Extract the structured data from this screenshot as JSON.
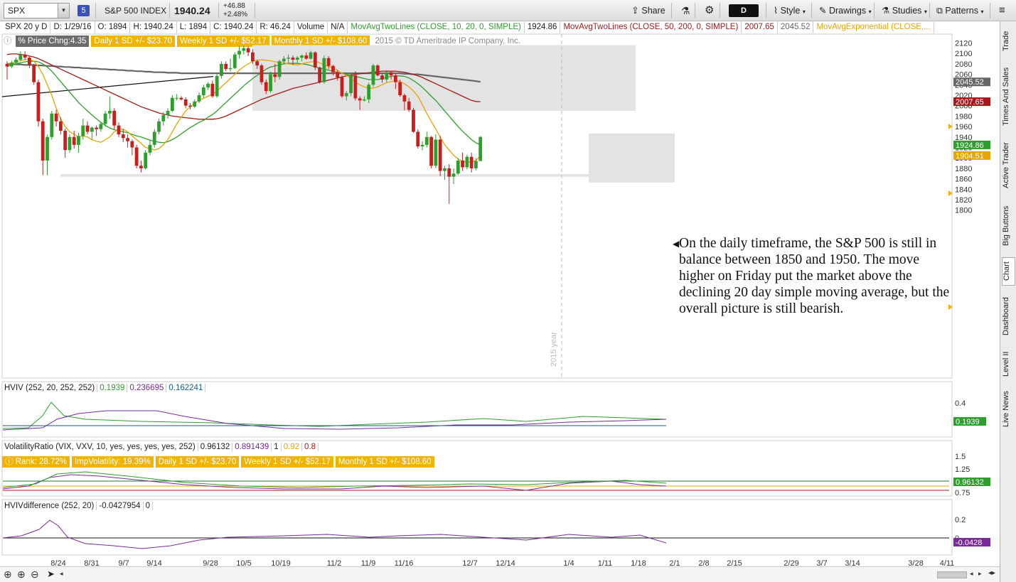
{
  "toolbar": {
    "symbol": "SPX",
    "badge": "5",
    "name": "S&P 500 INDEX",
    "last": "1940.24",
    "change": "+46.88",
    "change_pct": "+2.48%",
    "share": "Share",
    "style": "Style",
    "drawings": "Drawings",
    "studies": "Studies",
    "patterns": "Patterns",
    "period_btn": "D"
  },
  "infobar": {
    "period": "SPX 20 y D",
    "date": "D: 1/29/16",
    "open": "O: 1894",
    "high": "H: 1940.24",
    "low": "L: 1894",
    "close": "C: 1940.24",
    "range": "R: 46.24",
    "volume": "Volume",
    "volume_val": "N/A",
    "study1": "MovAvgTwoLines (CLOSE, 10, 20, 0, SIMPLE)",
    "study1_val": "1924.86",
    "study2": "MovAvgTwoLines (CLOSE, 50, 200, 0, SIMPLE)",
    "study2_val1": "2007.65",
    "study2_val2": "2045.52",
    "study3": "MovAvgExponential (CLOSE,...",
    "price_chg": "% Price Chng:4.35",
    "daily_sd": "Daily 1 SD +/- $23.70",
    "weekly_sd": "Weekly 1 SD +/- $52.17",
    "monthly_sd": "Monthly 1 SD +/- $108.60",
    "copyright": "2015 © TD Ameritrade IP Company, Inc."
  },
  "sidebar": [
    "Trade",
    "Times And Sales",
    "Active Trader",
    "Big Buttons",
    "Chart",
    "Dashboard",
    "Level II",
    "Live News"
  ],
  "annotation": "On the daily timeframe, the S&P 500 is still in balance between 1850 and 1950. The move higher on Friday put the market above the declining 20 day simple moving average, but the overall picture is still bearish.",
  "year_marker": "2015 year",
  "panels": {
    "hviv": {
      "label": "HVIV (252, 20, 252, 252)",
      "v1": "0.1939",
      "v2": "0.236695",
      "v3": "0.162241",
      "ticks": [
        "0.4"
      ],
      "badge": "0.1939"
    },
    "vr": {
      "label": "VolatilityRatio (VIX, VXV, 10, yes, yes, yes, yes, 252)",
      "v1": "0.96132",
      "v2": "0.891439",
      "v3": "1",
      "v4": "0.92",
      "v5": "0.8",
      "rank": "Rank: 28.72%",
      "impvol": "ImpVolatility: 19.39%",
      "daily": "Daily 1 SD +/- $23.70",
      "weekly": "Weekly 1 SD +/- $52.17",
      "monthly": "Monthly 1 SD +/- $108.60",
      "ticks": [
        "1.5",
        "1.25",
        "0.75"
      ],
      "badge": "0.96132"
    },
    "hvdiff": {
      "label": "HVIVdifference (252, 20)",
      "v1": "-0.0427954",
      "v2": "0",
      "ticks": [
        "0.2",
        "0"
      ],
      "badge": "-0.0428"
    }
  },
  "colors": {
    "up": "#2e9e2e",
    "down": "#c81e1e",
    "sma10": "#e8a400",
    "sma20": "#2e9e2e",
    "sma50": "#a31a1a",
    "sma200": "#666666",
    "box": "#e3e3e3"
  },
  "chart_data": {
    "type": "candlestick",
    "y_range": [
      1800,
      2120
    ],
    "y_ticks": [
      2120,
      2100,
      2080,
      2060,
      2040,
      2020,
      2000,
      1980,
      1960,
      1940,
      1920,
      1900,
      1880,
      1860,
      1840,
      1820,
      1800
    ],
    "x_ticks": [
      "8/24",
      "8/31",
      "9/7",
      "9/14",
      "9/28",
      "10/5",
      "10/19",
      "11/2",
      "11/9",
      "11/16",
      "12/7",
      "12/14",
      "1/4",
      "1/11",
      "1/18",
      "2/1",
      "2/8",
      "2/15",
      "2/29",
      "3/7",
      "3/14",
      "3/28",
      "4/11"
    ],
    "price_badges": [
      {
        "value": "2045.52",
        "color": "#666666"
      },
      {
        "value": "2007.65",
        "color": "#a31a1a"
      },
      {
        "value": "1924.86",
        "color": "#2e9e2e"
      },
      {
        "value": "1904.51",
        "color": "#e8a400"
      }
    ],
    "balance_range": [
      1850,
      1950
    ],
    "candles": [
      [
        2080,
        2085,
        2050,
        2075
      ],
      [
        2075,
        2086,
        2072,
        2082
      ],
      [
        2082,
        2092,
        2078,
        2088
      ],
      [
        2088,
        2104,
        2085,
        2098
      ],
      [
        2098,
        2104,
        2088,
        2092
      ],
      [
        2092,
        2096,
        2072,
        2078
      ],
      [
        2078,
        2080,
        2040,
        2045
      ],
      [
        2045,
        2050,
        1960,
        1970
      ],
      [
        1970,
        1975,
        1867,
        1895
      ],
      [
        1895,
        1945,
        1867,
        1940
      ],
      [
        1940,
        1990,
        1935,
        1985
      ],
      [
        1985,
        1992,
        1960,
        1970
      ],
      [
        1970,
        1978,
        1945,
        1952
      ],
      [
        1952,
        1956,
        1900,
        1915
      ],
      [
        1915,
        1945,
        1910,
        1940
      ],
      [
        1940,
        1952,
        1918,
        1925
      ],
      [
        1925,
        1948,
        1910,
        1942
      ],
      [
        1942,
        1975,
        1935,
        1962
      ],
      [
        1962,
        1970,
        1945,
        1950
      ],
      [
        1950,
        1960,
        1935,
        1958
      ],
      [
        1958,
        1962,
        1942,
        1955
      ],
      [
        1955,
        1968,
        1950,
        1965
      ],
      [
        1965,
        1990,
        1960,
        1985
      ],
      [
        1985,
        2018,
        1975,
        1990
      ],
      [
        1990,
        1995,
        1955,
        1962
      ],
      [
        1962,
        1968,
        1940,
        1945
      ],
      [
        1945,
        1955,
        1930,
        1938
      ],
      [
        1938,
        1945,
        1920,
        1932
      ],
      [
        1932,
        1935,
        1905,
        1920
      ],
      [
        1920,
        1925,
        1880,
        1885
      ],
      [
        1885,
        1895,
        1872,
        1880
      ],
      [
        1880,
        1915,
        1878,
        1910
      ],
      [
        1910,
        1935,
        1905,
        1925
      ],
      [
        1925,
        1955,
        1920,
        1950
      ],
      [
        1950,
        1975,
        1945,
        1970
      ],
      [
        1970,
        1988,
        1962,
        1982
      ],
      [
        1982,
        1995,
        1975,
        1990
      ],
      [
        1990,
        2020,
        1988,
        2015
      ],
      [
        2015,
        2022,
        2010,
        2015
      ],
      [
        2015,
        2018,
        2010,
        2012
      ],
      [
        2012,
        2016,
        1995,
        2000
      ],
      [
        2000,
        2005,
        1993,
        1998
      ],
      [
        1998,
        2012,
        1995,
        2008
      ],
      [
        2008,
        2025,
        2005,
        2020
      ],
      [
        2020,
        2040,
        2015,
        2035
      ],
      [
        2035,
        2045,
        2030,
        2042
      ],
      [
        2042,
        2048,
        2015,
        2018
      ],
      [
        2018,
        2062,
        2015,
        2057
      ],
      [
        2057,
        2085,
        2052,
        2080
      ],
      [
        2080,
        2085,
        2066,
        2070
      ],
      [
        2070,
        2090,
        2065,
        2072
      ],
      [
        2072,
        2102,
        2070,
        2098
      ],
      [
        2098,
        2114,
        2090,
        2105
      ],
      [
        2105,
        2115,
        2098,
        2110
      ],
      [
        2110,
        2113,
        2095,
        2102
      ],
      [
        2102,
        2108,
        2080,
        2085
      ],
      [
        2085,
        2088,
        2070,
        2077
      ],
      [
        2077,
        2080,
        2040,
        2045
      ],
      [
        2045,
        2050,
        2022,
        2028
      ],
      [
        2028,
        2065,
        2025,
        2060
      ],
      [
        2060,
        2080,
        2045,
        2055
      ],
      [
        2055,
        2088,
        2050,
        2085
      ],
      [
        2085,
        2095,
        2080,
        2090
      ],
      [
        2090,
        2098,
        2082,
        2092
      ],
      [
        2092,
        2096,
        2078,
        2088
      ],
      [
        2088,
        2095,
        2080,
        2092
      ],
      [
        2092,
        2098,
        2085,
        2096
      ],
      [
        2096,
        2102,
        2088,
        2090
      ],
      [
        2090,
        2105,
        2088,
        2102
      ],
      [
        2102,
        2104,
        2068,
        2073
      ],
      [
        2073,
        2075,
        2042,
        2045
      ],
      [
        2045,
        2096,
        2042,
        2091
      ],
      [
        2091,
        2095,
        2070,
        2076
      ],
      [
        2076,
        2078,
        2058,
        2064
      ],
      [
        2064,
        2068,
        2048,
        2054
      ],
      [
        2054,
        2058,
        2015,
        2018
      ],
      [
        2018,
        2028,
        2010,
        2024
      ],
      [
        2024,
        2062,
        2018,
        2058
      ],
      [
        2058,
        2066,
        2010,
        2014
      ],
      [
        2014,
        2018,
        1992,
        2010
      ],
      [
        2010,
        2018,
        2008,
        2012
      ],
      [
        2012,
        2044,
        2005,
        2040
      ],
      [
        2040,
        2080,
        2036,
        2077
      ],
      [
        2077,
        2079,
        2056,
        2058
      ],
      [
        2058,
        2062,
        2044,
        2050
      ],
      [
        2050,
        2068,
        2045,
        2064
      ],
      [
        2064,
        2065,
        2050,
        2058
      ],
      [
        2058,
        2062,
        2032,
        2045
      ],
      [
        2045,
        2050,
        2017,
        2020
      ],
      [
        2020,
        2023,
        1991,
        2008
      ],
      [
        2008,
        2015,
        1988,
        1992
      ],
      [
        1992,
        1996,
        1948,
        1950
      ],
      [
        1950,
        1955,
        1918,
        1922
      ],
      [
        1922,
        1932,
        1915,
        1925
      ],
      [
        1925,
        1950,
        1920,
        1940
      ],
      [
        1940,
        1942,
        1880,
        1885
      ],
      [
        1885,
        1945,
        1880,
        1935
      ],
      [
        1935,
        1942,
        1865,
        1875
      ],
      [
        1875,
        1885,
        1858,
        1880
      ],
      [
        1880,
        1888,
        1812,
        1864
      ],
      [
        1864,
        1880,
        1850,
        1870
      ],
      [
        1870,
        1900,
        1868,
        1895
      ],
      [
        1895,
        1910,
        1875,
        1882
      ],
      [
        1882,
        1906,
        1878,
        1902
      ],
      [
        1902,
        1910,
        1872,
        1880
      ],
      [
        1880,
        1900,
        1876,
        1894
      ],
      [
        1894,
        1942,
        1894,
        1940
      ]
    ],
    "sma10": [
      2080,
      2082,
      2084,
      2086,
      2088,
      2089,
      2085,
      2075,
      2060,
      2040,
      2020,
      1995,
      1975,
      1960,
      1950,
      1945,
      1940,
      1942,
      1940,
      1935,
      1932,
      1930,
      1935,
      1940,
      1950,
      1955,
      1955,
      1950,
      1942,
      1935,
      1928,
      1920,
      1918,
      1915,
      1918,
      1925,
      1935,
      1950,
      1965,
      1978,
      1990,
      1998,
      2005,
      2010,
      2014,
      2018,
      2022,
      2028,
      2036,
      2044,
      2052,
      2060,
      2068,
      2075,
      2080,
      2085,
      2087,
      2088,
      2087,
      2086,
      2084,
      2083,
      2082,
      2080,
      2079,
      2078,
      2080,
      2082,
      2084,
      2085,
      2082,
      2078,
      2075,
      2072,
      2068,
      2062,
      2058,
      2052,
      2045,
      2040,
      2036,
      2033,
      2034,
      2036,
      2040,
      2044,
      2046,
      2048,
      2046,
      2042,
      2036,
      2028,
      2018,
      2002,
      1985,
      1970,
      1955,
      1940,
      1925,
      1915,
      1905,
      1898,
      1893,
      1892,
      1892,
      1895,
      1904.51
    ],
    "sma20": [
      2075,
      2078,
      2080,
      2082,
      2084,
      2085,
      2085,
      2084,
      2080,
      2074,
      2066,
      2056,
      2046,
      2036,
      2026,
      2016,
      2006,
      1998,
      1990,
      1982,
      1975,
      1968,
      1962,
      1957,
      1954,
      1952,
      1950,
      1948,
      1945,
      1942,
      1940,
      1937,
      1934,
      1932,
      1930,
      1929,
      1931,
      1935,
      1940,
      1946,
      1952,
      1958,
      1963,
      1968,
      1972,
      1978,
      1983,
      1990,
      1998,
      2006,
      2014,
      2022,
      2030,
      2038,
      2045,
      2052,
      2058,
      2064,
      2070,
      2074,
      2076,
      2078,
      2080,
      2081,
      2081,
      2081,
      2080,
      2079,
      2077,
      2074,
      2072,
      2070,
      2068,
      2066,
      2064,
      2062,
      2060,
      2058,
      2056,
      2054,
      2052,
      2050,
      2050,
      2050,
      2052,
      2054,
      2056,
      2057,
      2057,
      2056,
      2053,
      2048,
      2042,
      2035,
      2027,
      2018,
      2010,
      2000,
      1990,
      1980,
      1970,
      1960,
      1951,
      1943,
      1935,
      1929,
      1924.86
    ],
    "sma50": [
      2098,
      2099,
      2099,
      2098,
      2097,
      2095,
      2093,
      2090,
      2086,
      2082,
      2078,
      2074,
      2070,
      2066,
      2062,
      2058,
      2054,
      2050,
      2046,
      2042,
      2038,
      2034,
      2030,
      2026,
      2022,
      2018,
      2014,
      2010,
      2006,
      2002,
      1998,
      1995,
      1992,
      1989,
      1986,
      1984,
      1982,
      1980,
      1979,
      1978,
      1977,
      1976,
      1975,
      1974,
      1974,
      1974,
      1974,
      1975,
      1977,
      1980,
      1984,
      1988,
      1992,
      1996,
      2000,
      2004,
      2008,
      2012,
      2015,
      2018,
      2021,
      2024,
      2027,
      2030,
      2033,
      2035,
      2037,
      2039,
      2041,
      2043,
      2045,
      2047,
      2049,
      2051,
      2053,
      2055,
      2057,
      2059,
      2060,
      2061,
      2062,
      2063,
      2064,
      2065,
      2066,
      2066,
      2066,
      2066,
      2065,
      2064,
      2062,
      2060,
      2057,
      2054,
      2050,
      2046,
      2042,
      2038,
      2034,
      2030,
      2026,
      2022,
      2018,
      2014,
      2010,
      2008,
      2007.65
    ],
    "sma200": [
      2080,
      2080,
      2079,
      2079,
      2078,
      2078,
      2078,
      2077,
      2077,
      2076,
      2076,
      2075,
      2075,
      2074,
      2074,
      2073,
      2073,
      2072,
      2072,
      2071,
      2071,
      2070,
      2070,
      2069,
      2069,
      2068,
      2068,
      2067,
      2067,
      2066,
      2066,
      2065,
      2065,
      2064,
      2064,
      2064,
      2063,
      2063,
      2063,
      2062,
      2062,
      2062,
      2062,
      2062,
      2062,
      2062,
      2062,
      2062,
      2062,
      2062,
      2062,
      2062,
      2062,
      2062,
      2062,
      2062,
      2062,
      2062,
      2062,
      2062,
      2062,
      2062,
      2062,
      2062,
      2062,
      2062,
      2062,
      2062,
      2062,
      2062,
      2062,
      2062,
      2062,
      2062,
      2062,
      2062,
      2062,
      2062,
      2062,
      2062,
      2062,
      2062,
      2062,
      2062,
      2062,
      2062,
      2062,
      2062,
      2062,
      2061,
      2061,
      2060,
      2060,
      2059,
      2058,
      2057,
      2056,
      2055,
      2054,
      2053,
      2052,
      2051,
      2050,
      2049,
      2048,
      2047,
      2045.52
    ],
    "trendline": [
      [
        0,
        2020
      ],
      [
        62,
        2060
      ]
    ]
  }
}
